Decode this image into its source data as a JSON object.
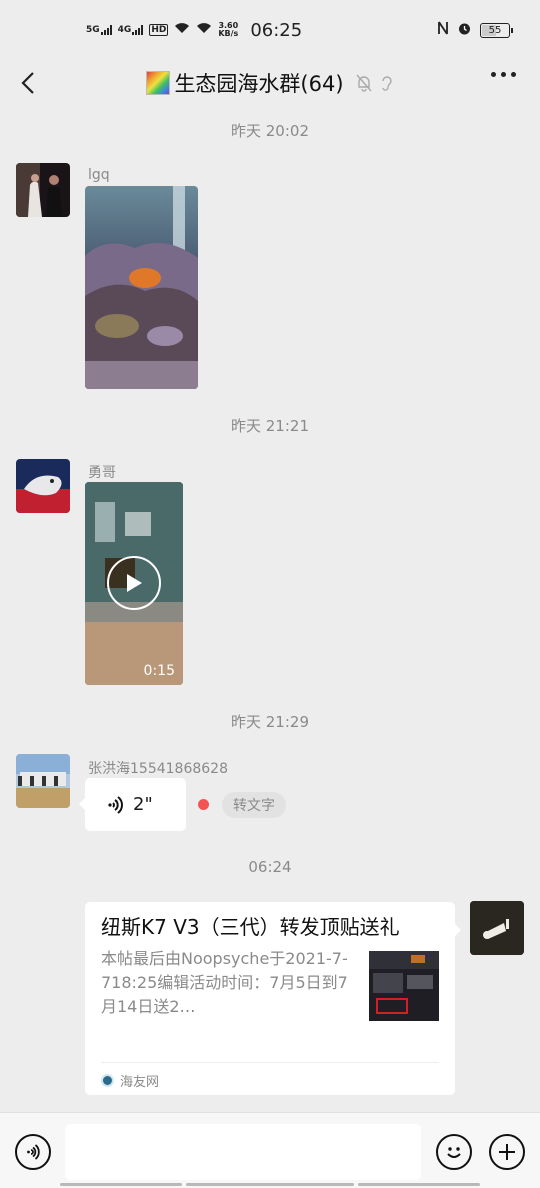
{
  "status_bar": {
    "signal_1": "5G",
    "signal_2": "4G",
    "hd_label": "HD",
    "speed_value": "3.60",
    "speed_unit": "KB/s",
    "time": "06:25",
    "battery": "55"
  },
  "chat": {
    "title": "生态园海水群(64)",
    "icons": [
      "mute-bell-icon",
      "ear-icon"
    ]
  },
  "messages": [
    {
      "type": "timestamp",
      "text": "昨天 20:02"
    },
    {
      "type": "image",
      "sender": "lgq"
    },
    {
      "type": "timestamp",
      "text": "昨天 21:21"
    },
    {
      "type": "video",
      "sender": "勇哥",
      "duration": "0:15"
    },
    {
      "type": "timestamp",
      "text": "昨天 21:29"
    },
    {
      "type": "voice",
      "sender": "张洪海15541868628",
      "length": "2\"",
      "action": "转文字"
    },
    {
      "type": "timestamp",
      "text": "06:24"
    },
    {
      "type": "link",
      "title": "纽斯K7 V3（三代）转发顶贴送礼",
      "description": "本帖最后由Noopsyche于2021-7-718:25编辑活动时间：7月5日到7月14日送2…",
      "source": "海友网"
    }
  ],
  "colors": {
    "background": "#ededed",
    "unread_dot": "#f25454"
  }
}
